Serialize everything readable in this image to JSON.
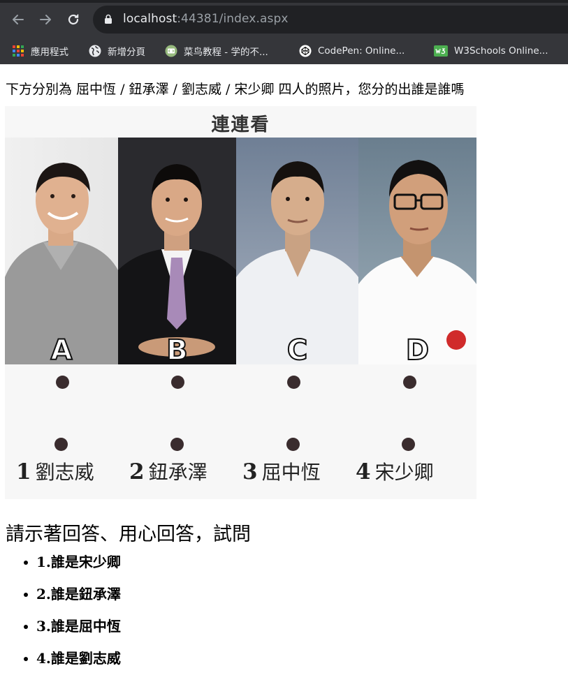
{
  "browser": {
    "url_host": "localhost",
    "url_rest": ":44381/index.aspx",
    "bookmarks": [
      {
        "label": "應用程式",
        "icon": "apps-grid-icon"
      },
      {
        "label": "新增分頁",
        "icon": "globe-icon"
      },
      {
        "label": "菜鸟教程 - 学的不...",
        "icon": "runoob-icon"
      },
      {
        "label": "CodePen: Online...",
        "icon": "codepen-icon"
      },
      {
        "label": "W3Schools Online...",
        "icon": "w3schools-icon"
      }
    ]
  },
  "page": {
    "intro": "下方分別為 屈中恆 / 鈕承澤 / 劉志威 / 宋少卿 四人的照片，您分的出誰是誰嗎",
    "board": {
      "title": "連連看",
      "letters": [
        "A",
        "B",
        "C",
        "D"
      ],
      "names": [
        {
          "num": "1",
          "name": "劉志威"
        },
        {
          "num": "2",
          "name": "鈕承澤"
        },
        {
          "num": "3",
          "name": "屈中恆"
        },
        {
          "num": "4",
          "name": "宋少卿"
        }
      ]
    },
    "question_heading": "請示著回答、用心回答，試問",
    "questions": [
      "1.誰是宋少卿",
      "2.誰是鈕承澤",
      "3.誰是屈中恆",
      "4.誰是劉志威"
    ]
  }
}
